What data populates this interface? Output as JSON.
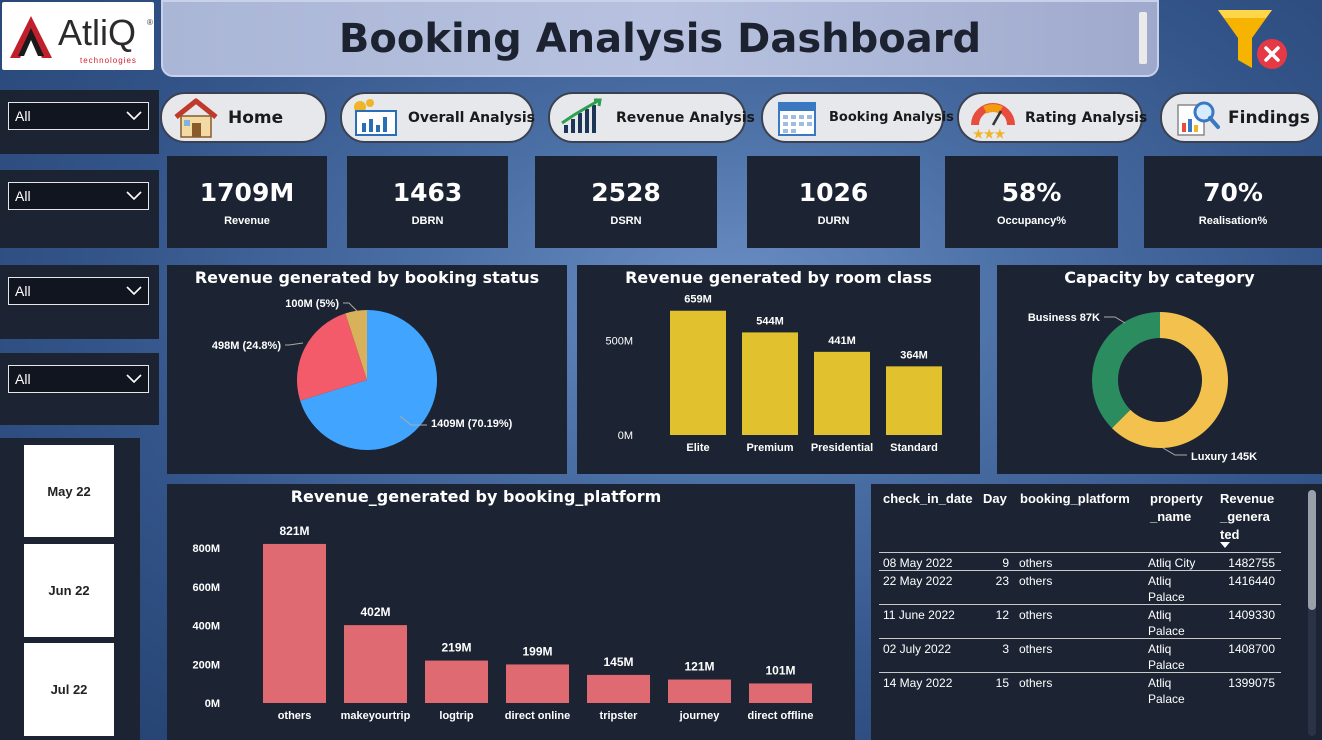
{
  "logo": {
    "name": "AtliQ",
    "tagline": "technologies"
  },
  "header": {
    "title": "Booking Analysis Dashboard"
  },
  "icons": {
    "filter": "filter-clear-icon",
    "dropdown": "chevron-down-icon"
  },
  "slicers": [
    {
      "value": "All"
    },
    {
      "value": "All"
    },
    {
      "value": "All"
    },
    {
      "value": "All"
    }
  ],
  "months": [
    "May 22",
    "Jun 22",
    "Jul 22"
  ],
  "nav": [
    {
      "label": "Home",
      "icon": "home-icon"
    },
    {
      "label": "Overall Analysis",
      "icon": "analytics-icon"
    },
    {
      "label": "Revenue Analysis",
      "icon": "revenue-icon"
    },
    {
      "label": "Booking Analysis",
      "icon": "calendar-icon"
    },
    {
      "label": "Rating Analysis",
      "icon": "gauge-icon"
    },
    {
      "label": "Findings",
      "icon": "magnifier-icon"
    }
  ],
  "kpis": [
    {
      "value": "1709M",
      "label": "Revenue"
    },
    {
      "value": "1463",
      "label": "DBRN"
    },
    {
      "value": "2528",
      "label": "DSRN"
    },
    {
      "value": "1026",
      "label": "DURN"
    },
    {
      "value": "58%",
      "label": "Occupancy%"
    },
    {
      "value": "70%",
      "label": "Realisation%"
    }
  ],
  "chart_data": [
    {
      "type": "pie",
      "title": "Revenue generated by booking status",
      "slices": [
        {
          "label": "1409M (70.19%)",
          "value": 70.19,
          "color": "#41a5ff"
        },
        {
          "label": "498M (24.8%)",
          "value": 24.8,
          "color": "#f35a6a"
        },
        {
          "label": "100M (5%)",
          "value": 5,
          "color": "#d8b25a"
        }
      ]
    },
    {
      "type": "bar",
      "title": "Revenue generated by room class",
      "categories": [
        "Elite",
        "Premium",
        "Presidential",
        "Standard"
      ],
      "values": [
        659,
        544,
        441,
        364
      ],
      "data_labels": [
        "659M",
        "544M",
        "441M",
        "364M"
      ],
      "y_ticks": [
        "0M",
        "500M"
      ],
      "ylim": [
        0,
        700
      ],
      "color": "#e2c12f"
    },
    {
      "type": "pie",
      "subtype": "donut",
      "title": "Capacity by category",
      "slices": [
        {
          "label": "Luxury 145K",
          "value": 145,
          "color": "#f2c14e"
        },
        {
          "label": "Business 87K",
          "value": 87,
          "color": "#2b8c5f"
        }
      ]
    },
    {
      "type": "bar",
      "title": "Revenue_generated by booking_platform",
      "categories": [
        "others",
        "makeyourtrip",
        "logtrip",
        "direct online",
        "tripster",
        "journey",
        "direct offline"
      ],
      "values": [
        821,
        402,
        219,
        199,
        145,
        121,
        101
      ],
      "data_labels": [
        "821M",
        "402M",
        "219M",
        "199M",
        "145M",
        "121M",
        "101M"
      ],
      "y_ticks": [
        "0M",
        "200M",
        "400M",
        "600M",
        "800M"
      ],
      "ylim": [
        0,
        800
      ],
      "color": "#e06a72"
    }
  ],
  "table": {
    "headers": [
      "check_in_date",
      "Day",
      "booking_platform",
      "property\n_name",
      "Revenue\n_genera\nted"
    ],
    "rows": [
      {
        "date": "08 May 2022",
        "day": "9",
        "platform": "others",
        "property": "Atliq City",
        "revenue": "1482755"
      },
      {
        "date": "22 May 2022",
        "day": "23",
        "platform": "others",
        "property": "Atliq\nPalace",
        "revenue": "1416440"
      },
      {
        "date": "11 June 2022",
        "day": "12",
        "platform": "others",
        "property": "Atliq\nPalace",
        "revenue": "1409330"
      },
      {
        "date": "02 July 2022",
        "day": "3",
        "platform": "others",
        "property": "Atliq\nPalace",
        "revenue": "1408700"
      },
      {
        "date": "14 May 2022",
        "day": "15",
        "platform": "others",
        "property": "Atliq\nPalace",
        "revenue": "1399075"
      }
    ]
  }
}
